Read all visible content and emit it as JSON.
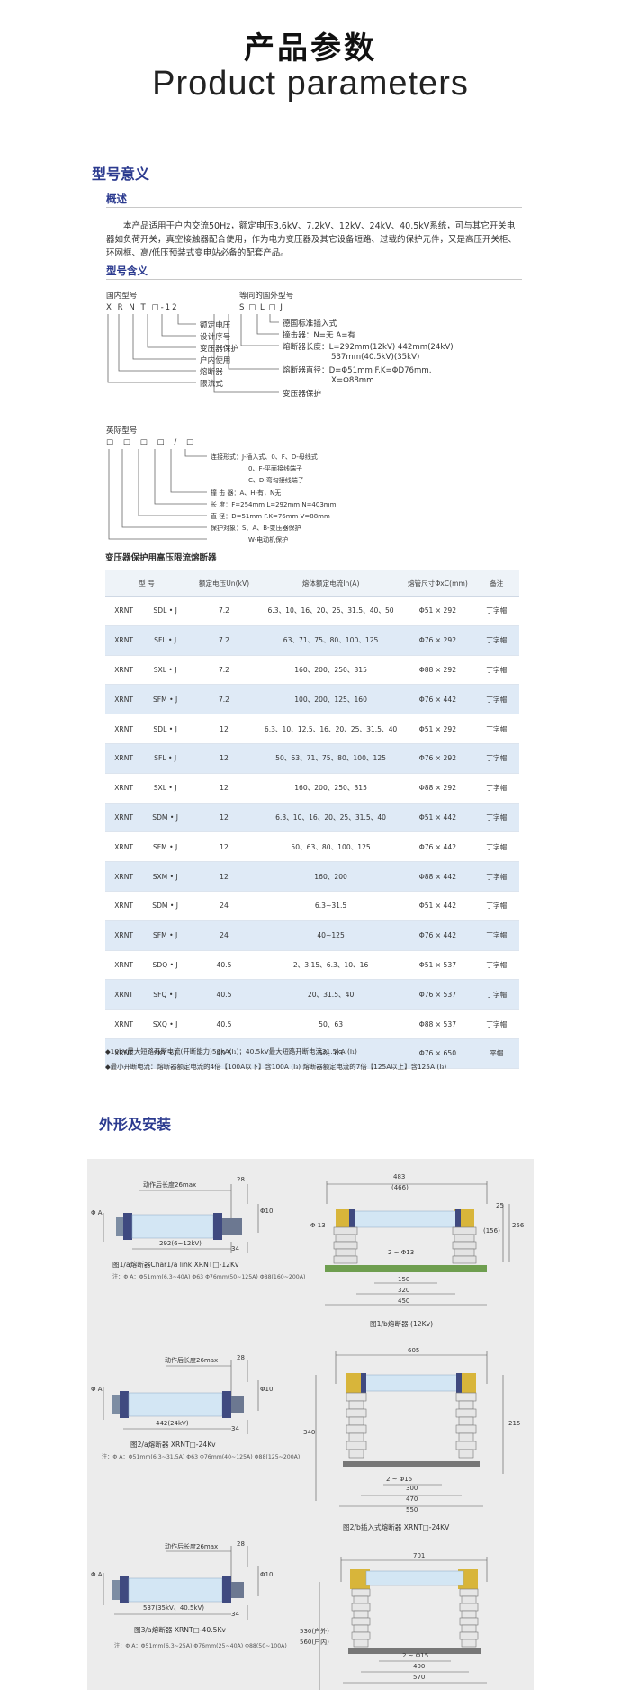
{
  "header": {
    "title_cn": "产品参数",
    "title_en": "Product parameters"
  },
  "model_section": {
    "title": "型号意义",
    "overview_label": "概述",
    "overview_text": "本产品适用于户内交流50Hz，额定电压3.6kV、7.2kV、12kV、24kV、40.5kV系统，可与其它开关电器如负荷开关，真空接触器配合使用，作为电力变压器及其它设备短路、过载的保护元件，又是高压开关柜、环网框、高/低压预装式变电站必备的配套产品。",
    "meaning_label": "型号含义",
    "domestic": {
      "label": "国内型号",
      "code": "X  R  N  T  □-12",
      "items": [
        "额定电压",
        "设计序号",
        "变压器保护",
        "户内使用",
        "熔断器",
        "限流式"
      ]
    },
    "foreign_equiv": {
      "label": "等同的国外型号",
      "code": "S □ L □ J",
      "items": [
        "德国标准插入式",
        "撞击器：N=无 A=有",
        "熔断器长度：L=292mm(12kV)   442mm(24kV)",
        "537mm(40.5kV)(35kV)",
        "熔断器直径：D=Φ51mm  F.K=ΦD76mm,",
        "X=Φ88mm",
        "变压器保护"
      ]
    },
    "intl": {
      "label": "英际型号",
      "code": "□ □ □ □ / □",
      "items": [
        "连接形式：J-插入式、0、F、D-母线式",
        "0、F-平面接线端子",
        "C、D-弯勾接线端子",
        "撞 击 器：A、H-有，N无",
        "长    度：F=254mm  L=292mm   N=403mm",
        "直    径：D=51mm  F.K=76mm    V=88mm",
        "保护对象：S、A、B-变压器保护",
        "W-电动机保护"
      ]
    }
  },
  "table": {
    "title": "变压器保护用高压限流熔断器",
    "headers": [
      "型  号",
      "额定电压Un(kV)",
      "熔体额定电流In(A)",
      "熔管尺寸ΦxC(mm)",
      "备注"
    ],
    "rows": [
      [
        "XRNT",
        "SDL • J",
        "7.2",
        "6.3、10、16、20、25、31.5、40、50",
        "Φ51 × 292",
        "丁字帽"
      ],
      [
        "XRNT",
        "SFL • J",
        "7.2",
        "63、71、75、80、100、125",
        "Φ76 × 292",
        "丁字帽"
      ],
      [
        "XRNT",
        "SXL • J",
        "7.2",
        "160、200、250、315",
        "Φ88 × 292",
        "丁字帽"
      ],
      [
        "XRNT",
        "SFM • J",
        "7.2",
        "100、200、125、160",
        "Φ76 × 442",
        "丁字帽"
      ],
      [
        "XRNT",
        "SDL • J",
        "12",
        "6.3、10、12.5、16、20、25、31.5、40",
        "Φ51 × 292",
        "丁字帽"
      ],
      [
        "XRNT",
        "SFL • J",
        "12",
        "50、63、71、75、80、100、125",
        "Φ76 × 292",
        "丁字帽"
      ],
      [
        "XRNT",
        "SXL • J",
        "12",
        "160、200、250、315",
        "Φ88 × 292",
        "丁字帽"
      ],
      [
        "XRNT",
        "SDM • J",
        "12",
        "6.3、10、16、20、25、31.5、40",
        "Φ51 × 442",
        "丁字帽"
      ],
      [
        "XRNT",
        "SFM • J",
        "12",
        "50、63、80、100、125",
        "Φ76 × 442",
        "丁字帽"
      ],
      [
        "XRNT",
        "SXM • J",
        "12",
        "160、200",
        "Φ88 × 442",
        "丁字帽"
      ],
      [
        "XRNT",
        "SDM • J",
        "24",
        "6.3~31.5",
        "Φ51 × 442",
        "丁字帽"
      ],
      [
        "XRNT",
        "SFM • J",
        "24",
        "40~125",
        "Φ76 × 442",
        "丁字帽"
      ],
      [
        "XRNT",
        "SDQ • J",
        "40.5",
        "2、3.15、6.3、10、16",
        "Φ51 × 537",
        "丁字帽"
      ],
      [
        "XRNT",
        "SFQ • J",
        "40.5",
        "20、31.5、40",
        "Φ76 × 537",
        "丁字帽"
      ],
      [
        "XRNT",
        "SXQ • J",
        "40.5",
        "50、63",
        "Φ88 × 537",
        "丁字帽"
      ],
      [
        "XRNT",
        "SKY • J",
        "40.5",
        "50、63",
        "Φ76 × 650",
        "平帽"
      ]
    ],
    "notes": [
      "◆10kV最大短路开断电流(开断能力)50kA(I₁)；40.5kV最大短路开断电流31.5kA (I₁)",
      "◆最小开断电流：熔断器额定电流的4倍【100A以下】含100A (I₃)    熔断器额定电流的7倍【125A以上】含125A (I₃)"
    ]
  },
  "install": {
    "title": "外形及安装",
    "fig1a": {
      "caption": "图1/a熔断器Char1/a link  XRNT□-12Kv",
      "note": "注：Φ A：Φ51mm(6.3~40A)  Φ63  Φ76mm(50~125A)  Φ88(160~200A)",
      "stroke": "动作后长度26max",
      "length": "292(6~12kV)",
      "d28": "28",
      "d34": "34",
      "dA": "Φ A",
      "d10": "Φ10"
    },
    "fig1b": {
      "caption": "图1/b熔断器 (12Kv)",
      "dims": [
        "483",
        "(466)",
        "Φ 13",
        "2 ~ Φ13",
        "150",
        "320",
        "450",
        "25",
        "256",
        "(156)"
      ]
    },
    "fig2a": {
      "caption": "图2/a熔断器 XRNT□-24Kv",
      "note": "注：Φ A：Φ51mm(6.3~31.5A)  Φ63  Φ76mm(40~125A)  Φ88(125~200A)",
      "stroke": "动作后长度26max",
      "length": "442(24kV)",
      "d28": "28",
      "d34": "34",
      "dA": "Φ A",
      "d10": "Φ10"
    },
    "fig2b": {
      "caption": "图2/b插入式熔断器 XRNT□-24KV",
      "dims": [
        "605",
        "340",
        "215",
        "2 ~ Φ15",
        "300",
        "470",
        "550"
      ]
    },
    "fig3a": {
      "caption": "图3/a熔断器 XRNT□-40.5Kv",
      "note": "注：Φ A：Φ51mm(6.3~25A)  Φ76mm(25~40A)  Φ88(50~100A)",
      "stroke": "动作后长度26max",
      "length": "537(35kV、40.5kV)",
      "d28": "28",
      "d34": "34",
      "dA": "Φ A",
      "d10": "Φ10"
    },
    "fig3b": {
      "dims": [
        "701",
        "530(户外)",
        "560(户内)",
        "2 ~ Φ15",
        "400",
        "570"
      ]
    }
  }
}
